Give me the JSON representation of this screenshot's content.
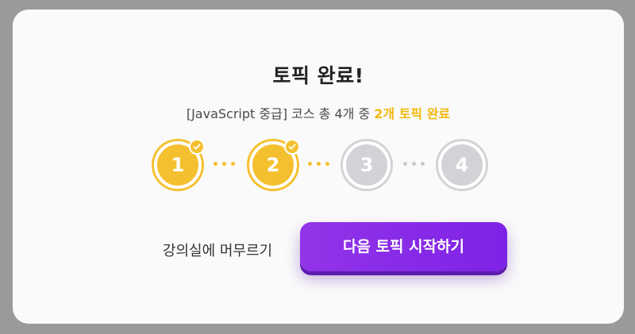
{
  "modal": {
    "title": "토픽 완료!",
    "subtitle_prefix": "[JavaScript 중급] 코스 총 4개 중 ",
    "subtitle_highlight": "2개 토픽 완료",
    "steps": [
      {
        "label": "1",
        "state": "done"
      },
      {
        "label": "2",
        "state": "done"
      },
      {
        "label": "3",
        "state": "todo"
      },
      {
        "label": "4",
        "state": "todo"
      }
    ],
    "stay_label": "강의실에 머무르기",
    "next_label": "다음 토픽 시작하기"
  },
  "colors": {
    "done": "#f5c02f",
    "todo": "#d2d3d6",
    "highlight": "#f2b90d",
    "button": "#8a2be2"
  }
}
